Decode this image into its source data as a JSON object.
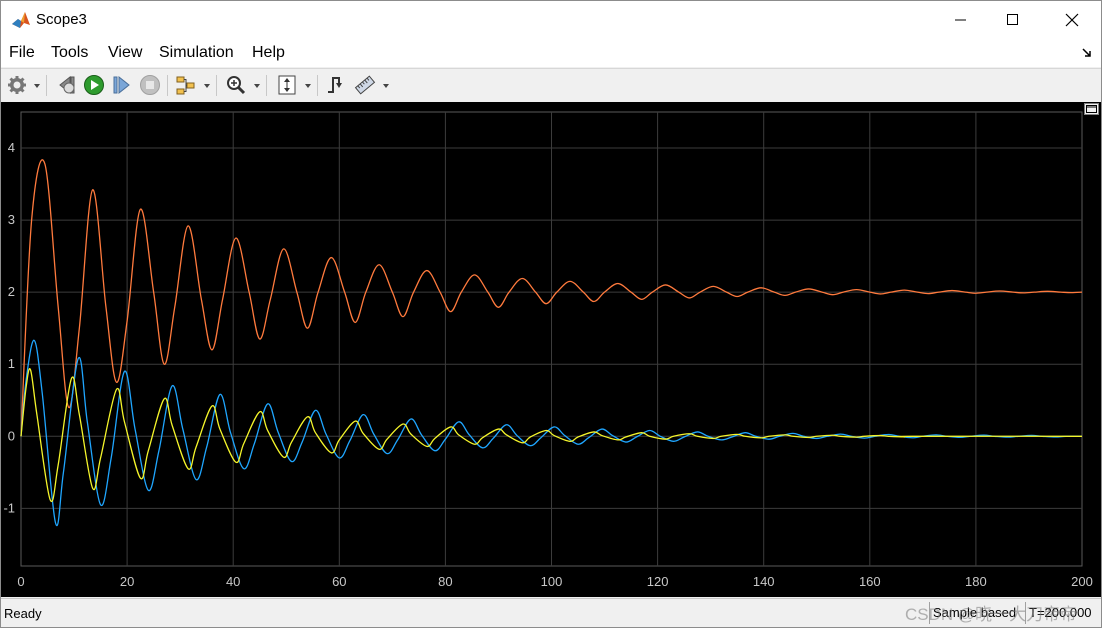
{
  "window": {
    "title": "Scope3",
    "controls": [
      "minimize",
      "maximize",
      "close"
    ]
  },
  "menu": {
    "items": [
      {
        "label": "File",
        "mnemonic": "F"
      },
      {
        "label": "Tools",
        "mnemonic": "T"
      },
      {
        "label": "View",
        "mnemonic": "V"
      },
      {
        "label": "Simulation",
        "mnemonic": "i"
      },
      {
        "label": "Help",
        "mnemonic": "H"
      }
    ]
  },
  "toolbar": {
    "buttons": [
      {
        "icon": "gear-icon",
        "has_dropdown": true
      },
      {
        "icon": "step-back-icon",
        "has_dropdown": false
      },
      {
        "icon": "run-icon",
        "has_dropdown": false
      },
      {
        "icon": "step-forward-icon",
        "has_dropdown": false
      },
      {
        "icon": "stop-icon",
        "has_dropdown": false,
        "disabled": true
      },
      {
        "icon": "highlight-block-icon",
        "has_dropdown": true
      },
      {
        "icon": "zoom-icon",
        "has_dropdown": true
      },
      {
        "icon": "autoscale-icon",
        "has_dropdown": true
      },
      {
        "icon": "triggers-icon",
        "has_dropdown": false
      },
      {
        "icon": "measurements-icon",
        "has_dropdown": true
      }
    ]
  },
  "status": {
    "left": "Ready",
    "sample_mode": "Sample based",
    "time": "T=200.000"
  },
  "watermark": "CSDN @晓一大刀帝帝",
  "colors": {
    "plot_background": "#000000",
    "grid": "#3c3c3c",
    "tick_text": "#c8c8c8",
    "series_orange": "#ff7a3d",
    "series_blue": "#1fa6ff",
    "series_yellow": "#f5f52a"
  },
  "chart_data": {
    "type": "line",
    "title": "",
    "xlabel": "",
    "ylabel": "",
    "xlim": [
      0,
      200
    ],
    "ylim": [
      -1.8,
      4.5
    ],
    "xticks": [
      0,
      20,
      40,
      60,
      80,
      100,
      120,
      140,
      160,
      180,
      200
    ],
    "yticks": [
      -1,
      0,
      1,
      2,
      3,
      4
    ],
    "grid": true,
    "legend": "none",
    "series": [
      {
        "color": "#ff7a3d",
        "points": [
          [
            0,
            0
          ],
          [
            2,
            3.0
          ],
          [
            4.5,
            3.78
          ],
          [
            7,
            1.8
          ],
          [
            9,
            0.4
          ],
          [
            11,
            1.5
          ],
          [
            13.5,
            3.42
          ],
          [
            16,
            1.8
          ],
          [
            18,
            0.75
          ],
          [
            20,
            1.6
          ],
          [
            22.5,
            3.15
          ],
          [
            25,
            2.0
          ],
          [
            27,
            1.0
          ],
          [
            29,
            1.8
          ],
          [
            31.5,
            2.92
          ],
          [
            34,
            1.9
          ],
          [
            36,
            1.2
          ],
          [
            38,
            1.9
          ],
          [
            40.5,
            2.75
          ],
          [
            43,
            2.0
          ],
          [
            45,
            1.35
          ],
          [
            47,
            1.9
          ],
          [
            49.5,
            2.6
          ],
          [
            52,
            2.0
          ],
          [
            54,
            1.5
          ],
          [
            56,
            2.0
          ],
          [
            58.5,
            2.48
          ],
          [
            61,
            2.0
          ],
          [
            63,
            1.58
          ],
          [
            65,
            2.0
          ],
          [
            67.5,
            2.38
          ],
          [
            70,
            2.0
          ],
          [
            72,
            1.66
          ],
          [
            74,
            2.0
          ],
          [
            76.5,
            2.3
          ],
          [
            79,
            2.0
          ],
          [
            81,
            1.73
          ],
          [
            83,
            2.0
          ],
          [
            85.5,
            2.24
          ],
          [
            88,
            2.0
          ],
          [
            90,
            1.79
          ],
          [
            92,
            2.0
          ],
          [
            94.5,
            2.19
          ],
          [
            97,
            2.0
          ],
          [
            99,
            1.84
          ],
          [
            101,
            2.0
          ],
          [
            103.5,
            2.15
          ],
          [
            106,
            2.0
          ],
          [
            108,
            1.87
          ],
          [
            110,
            2.0
          ],
          [
            112.5,
            2.12
          ],
          [
            115,
            2.0
          ],
          [
            117,
            1.9
          ],
          [
            119,
            2.0
          ],
          [
            121.5,
            2.1
          ],
          [
            124,
            2.0
          ],
          [
            126,
            1.92
          ],
          [
            128,
            2.0
          ],
          [
            130.5,
            2.08
          ],
          [
            133,
            2.0
          ],
          [
            135,
            1.94
          ],
          [
            137,
            2.0
          ],
          [
            139.5,
            2.06
          ],
          [
            142,
            2.0
          ],
          [
            144,
            1.955
          ],
          [
            146,
            2.0
          ],
          [
            148.5,
            2.045
          ],
          [
            151,
            2.0
          ],
          [
            153,
            1.965
          ],
          [
            155,
            2.0
          ],
          [
            157.5,
            2.035
          ],
          [
            160,
            2.0
          ],
          [
            162,
            1.975
          ],
          [
            164,
            2.0
          ],
          [
            166.5,
            2.028
          ],
          [
            169,
            2.0
          ],
          [
            171,
            1.98
          ],
          [
            173,
            2.0
          ],
          [
            175.5,
            2.022
          ],
          [
            178,
            2.0
          ],
          [
            180,
            1.985
          ],
          [
            182,
            2.0
          ],
          [
            184.5,
            2.016
          ],
          [
            187,
            2.0
          ],
          [
            189,
            1.99
          ],
          [
            191,
            2.0
          ],
          [
            193.5,
            2.012
          ],
          [
            196,
            2.0
          ],
          [
            198,
            1.993
          ],
          [
            200,
            2.0
          ]
        ]
      },
      {
        "color": "#1fa6ff",
        "points": [
          [
            0,
            0
          ],
          [
            1,
            0.8
          ],
          [
            2.5,
            1.33
          ],
          [
            4,
            0.6
          ],
          [
            6.5,
            -1.2
          ],
          [
            8,
            -0.5
          ],
          [
            10.8,
            1.08
          ],
          [
            12.5,
            0.2
          ],
          [
            15,
            -0.95
          ],
          [
            17,
            -0.3
          ],
          [
            19.5,
            0.9
          ],
          [
            21.5,
            0.1
          ],
          [
            24,
            -0.75
          ],
          [
            26,
            -0.2
          ],
          [
            28.5,
            0.7
          ],
          [
            30.5,
            0.1
          ],
          [
            33,
            -0.6
          ],
          [
            35,
            -0.15
          ],
          [
            37.5,
            0.58
          ],
          [
            39.5,
            0.05
          ],
          [
            42,
            -0.45
          ],
          [
            44,
            -0.1
          ],
          [
            46.5,
            0.45
          ],
          [
            48.5,
            0.05
          ],
          [
            51,
            -0.35
          ],
          [
            53,
            -0.08
          ],
          [
            55.5,
            0.36
          ],
          [
            57.5,
            0.03
          ],
          [
            60,
            -0.3
          ],
          [
            62,
            -0.06
          ],
          [
            64.5,
            0.3
          ],
          [
            66.5,
            0.03
          ],
          [
            69,
            -0.24
          ],
          [
            71,
            -0.05
          ],
          [
            73.5,
            0.24
          ],
          [
            75.5,
            0.02
          ],
          [
            78,
            -0.2
          ],
          [
            80,
            -0.04
          ],
          [
            82.5,
            0.2
          ],
          [
            84.5,
            0.02
          ],
          [
            87,
            -0.16
          ],
          [
            89,
            -0.03
          ],
          [
            91.5,
            0.16
          ],
          [
            93.5,
            0.01
          ],
          [
            96,
            -0.13
          ],
          [
            98,
            -0.02
          ],
          [
            100.5,
            0.13
          ],
          [
            102.5,
            0.01
          ],
          [
            105,
            -0.11
          ],
          [
            107,
            -0.02
          ],
          [
            109.5,
            0.1
          ],
          [
            111.5,
            0.01
          ],
          [
            114,
            -0.08
          ],
          [
            116,
            -0.01
          ],
          [
            118.5,
            0.08
          ],
          [
            120.5,
            0.0
          ],
          [
            123,
            -0.07
          ],
          [
            125,
            -0.01
          ],
          [
            127.5,
            0.06
          ],
          [
            129.5,
            0.0
          ],
          [
            132,
            -0.05
          ],
          [
            134,
            -0.01
          ],
          [
            136.5,
            0.05
          ],
          [
            138.5,
            0.0
          ],
          [
            141,
            -0.04
          ],
          [
            143,
            0.0
          ],
          [
            145.5,
            0.04
          ],
          [
            147.5,
            0.0
          ],
          [
            150,
            -0.03
          ],
          [
            152,
            0.0
          ],
          [
            154.5,
            0.03
          ],
          [
            156.5,
            0.0
          ],
          [
            159,
            -0.025
          ],
          [
            161,
            0.0
          ],
          [
            163.5,
            0.025
          ],
          [
            165.5,
            0.0
          ],
          [
            168,
            -0.02
          ],
          [
            170,
            0.0
          ],
          [
            172.5,
            0.02
          ],
          [
            174.5,
            0.0
          ],
          [
            177,
            -0.015
          ],
          [
            179,
            0.0
          ],
          [
            181.5,
            0.015
          ],
          [
            183.5,
            0.0
          ],
          [
            186,
            -0.012
          ],
          [
            188,
            0.0
          ],
          [
            190.5,
            0.012
          ],
          [
            192.5,
            0.0
          ],
          [
            195,
            -0.01
          ],
          [
            197,
            0.0
          ],
          [
            200,
            0.0
          ]
        ]
      },
      {
        "color": "#f5f52a",
        "points": [
          [
            0,
            0
          ],
          [
            1,
            0.7
          ],
          [
            1.8,
            0.92
          ],
          [
            3,
            0.3
          ],
          [
            5.5,
            -0.88
          ],
          [
            7,
            -0.4
          ],
          [
            9.5,
            0.8
          ],
          [
            11,
            0.3
          ],
          [
            13.5,
            -0.72
          ],
          [
            15,
            -0.3
          ],
          [
            18,
            0.65
          ],
          [
            19.5,
            0.2
          ],
          [
            22.5,
            -0.58
          ],
          [
            24,
            -0.2
          ],
          [
            27,
            0.52
          ],
          [
            28.5,
            0.15
          ],
          [
            31.5,
            -0.45
          ],
          [
            33,
            -0.15
          ],
          [
            36,
            0.42
          ],
          [
            37.5,
            0.1
          ],
          [
            40.5,
            -0.36
          ],
          [
            42,
            -0.1
          ],
          [
            45,
            0.34
          ],
          [
            46.5,
            0.08
          ],
          [
            49.5,
            -0.29
          ],
          [
            51,
            -0.08
          ],
          [
            54,
            0.27
          ],
          [
            55.5,
            0.05
          ],
          [
            58.5,
            -0.23
          ],
          [
            60,
            -0.05
          ],
          [
            63,
            0.21
          ],
          [
            64.5,
            0.04
          ],
          [
            67.5,
            -0.18
          ],
          [
            69,
            -0.04
          ],
          [
            72,
            0.17
          ],
          [
            73.5,
            0.03
          ],
          [
            76.5,
            -0.14
          ],
          [
            78,
            -0.03
          ],
          [
            81,
            0.13
          ],
          [
            82.5,
            0.02
          ],
          [
            85.5,
            -0.11
          ],
          [
            87,
            -0.02
          ],
          [
            90,
            0.1
          ],
          [
            91.5,
            0.02
          ],
          [
            94.5,
            -0.09
          ],
          [
            96,
            -0.01
          ],
          [
            99,
            0.08
          ],
          [
            100.5,
            0.01
          ],
          [
            103.5,
            -0.07
          ],
          [
            105,
            -0.01
          ],
          [
            108,
            0.06
          ],
          [
            109.5,
            0.01
          ],
          [
            112.5,
            -0.05
          ],
          [
            114,
            -0.01
          ],
          [
            117,
            0.05
          ],
          [
            118.5,
            0.0
          ],
          [
            121.5,
            -0.04
          ],
          [
            123,
            0.0
          ],
          [
            126,
            0.035
          ],
          [
            127.5,
            0.0
          ],
          [
            130.5,
            -0.03
          ],
          [
            132,
            0.0
          ],
          [
            135,
            0.027
          ],
          [
            136.5,
            0.0
          ],
          [
            139.5,
            -0.022
          ],
          [
            141,
            0.0
          ],
          [
            144,
            0.02
          ],
          [
            145.5,
            0.0
          ],
          [
            148.5,
            -0.016
          ],
          [
            150,
            0.0
          ],
          [
            153,
            0.014
          ],
          [
            154.5,
            0.0
          ],
          [
            157.5,
            -0.012
          ],
          [
            159,
            0.0
          ],
          [
            162,
            0.01
          ],
          [
            163.5,
            0.0
          ],
          [
            166.5,
            -0.008
          ],
          [
            168,
            0.0
          ],
          [
            200,
            0.0
          ]
        ]
      }
    ]
  }
}
